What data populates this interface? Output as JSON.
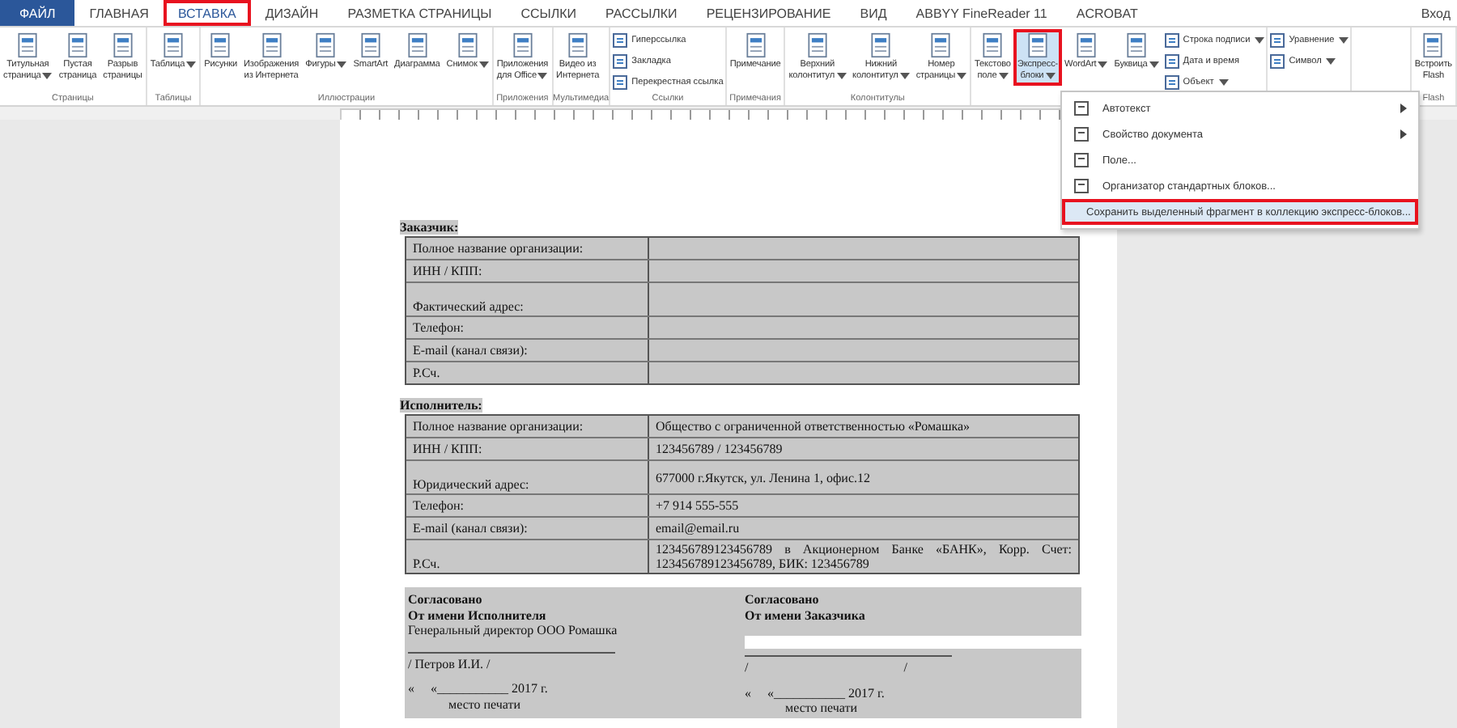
{
  "tabs": [
    {
      "label": "ФАЙЛ",
      "kind": "file",
      "selected": false
    },
    {
      "label": "ГЛАВНАЯ",
      "kind": "tab",
      "selected": false
    },
    {
      "label": "ВСТАВКА",
      "kind": "tab",
      "selected": true
    },
    {
      "label": "ДИЗАЙН",
      "kind": "tab",
      "selected": false
    },
    {
      "label": "РАЗМЕТКА СТРАНИЦЫ",
      "kind": "tab",
      "selected": false
    },
    {
      "label": "ССЫЛКИ",
      "kind": "tab",
      "selected": false
    },
    {
      "label": "РАССЫЛКИ",
      "kind": "tab",
      "selected": false
    },
    {
      "label": "РЕЦЕНЗИРОВАНИЕ",
      "kind": "tab",
      "selected": false
    },
    {
      "label": "ВИД",
      "kind": "tab",
      "selected": false
    },
    {
      "label": "ABBYY FineReader 11",
      "kind": "tab",
      "selected": false
    },
    {
      "label": "ACROBAT",
      "kind": "tab",
      "selected": false
    }
  ],
  "sign_in": "Вход",
  "ribbon": {
    "groups": [
      {
        "label": "Страницы",
        "items": [
          {
            "kind": "large",
            "label": "Титульная\nстраница",
            "dropdown": true,
            "pressed": false
          },
          {
            "kind": "large",
            "label": "Пустая\nстраница",
            "dropdown": false,
            "pressed": false
          },
          {
            "kind": "large",
            "label": "Разрыв\nстраницы",
            "dropdown": false,
            "pressed": false
          }
        ]
      },
      {
        "label": "Таблицы",
        "items": [
          {
            "kind": "large",
            "label": "Таблица",
            "dropdown": true,
            "pressed": false
          }
        ]
      },
      {
        "label": "Иллюстрации",
        "items": [
          {
            "kind": "large",
            "label": "Рисунки",
            "dropdown": false,
            "pressed": false
          },
          {
            "kind": "large",
            "label": "Изображения\nиз Интернета",
            "dropdown": false,
            "pressed": false
          },
          {
            "kind": "large",
            "label": "Фигуры",
            "dropdown": true,
            "pressed": false
          },
          {
            "kind": "large",
            "label": "SmartArt",
            "dropdown": false,
            "pressed": false
          },
          {
            "kind": "large",
            "label": "Диаграмма",
            "dropdown": false,
            "pressed": false
          },
          {
            "kind": "large",
            "label": "Снимок",
            "dropdown": true,
            "pressed": false
          }
        ]
      },
      {
        "label": "Приложения",
        "items": [
          {
            "kind": "large",
            "label": "Приложения\nдля Office",
            "dropdown": true,
            "pressed": false
          }
        ]
      },
      {
        "label": "Мультимедиа",
        "items": [
          {
            "kind": "large",
            "label": "Видео из\nИнтернета",
            "dropdown": false,
            "pressed": false
          }
        ]
      },
      {
        "label": "Ссылки",
        "items": [
          {
            "kind": "small",
            "label": "Гиперссылка",
            "dropdown": false,
            "pressed": false
          },
          {
            "kind": "small",
            "label": "Закладка",
            "dropdown": false,
            "pressed": false
          },
          {
            "kind": "small",
            "label": "Перекрестная ссылка",
            "dropdown": false,
            "pressed": false
          }
        ]
      },
      {
        "label": "Примечания",
        "items": [
          {
            "kind": "large",
            "label": "Примечание",
            "dropdown": false,
            "pressed": false
          }
        ]
      },
      {
        "label": "Колонтитулы",
        "items": [
          {
            "kind": "large",
            "label": "Верхний\nколонтитул",
            "dropdown": true,
            "pressed": false
          },
          {
            "kind": "large",
            "label": "Нижний\nколонтитул",
            "dropdown": true,
            "pressed": false
          },
          {
            "kind": "large",
            "label": "Номер\nстраницы",
            "dropdown": true,
            "pressed": false
          }
        ]
      },
      {
        "items": [
          {
            "kind": "large",
            "label": "Текстово\nполе",
            "dropdown": true,
            "pressed": false
          },
          {
            "kind": "large",
            "label": "Экспресс-\nблоки",
            "dropdown": true,
            "pressed": true
          },
          {
            "kind": "large",
            "label": "WordArt",
            "dropdown": true,
            "pressed": false
          },
          {
            "kind": "large",
            "label": "Буквица",
            "dropdown": true,
            "pressed": false
          },
          {
            "kind": "small",
            "label": "Строка подписи",
            "dropdown": true,
            "pressed": false
          },
          {
            "kind": "small",
            "label": "Дата и время",
            "dropdown": false,
            "pressed": false
          },
          {
            "kind": "small",
            "label": "Объект",
            "dropdown": true,
            "pressed": false
          }
        ]
      },
      {
        "items": [
          {
            "kind": "small",
            "label": "Уравнение",
            "dropdown": true,
            "pressed": false
          },
          {
            "kind": "small",
            "label": "Символ",
            "dropdown": true,
            "pressed": false
          }
        ]
      },
      {
        "label": "Flash",
        "items": [
          {
            "kind": "large",
            "label": "Встроить\nFlash",
            "dropdown": false,
            "pressed": false
          }
        ]
      }
    ]
  },
  "menu": {
    "items": [
      {
        "label": "Автотекст",
        "submenu": true,
        "highlighted": false
      },
      {
        "label": "Свойство документа",
        "submenu": true,
        "highlighted": false
      },
      {
        "label": "Поле...",
        "submenu": false,
        "highlighted": false
      },
      {
        "label": "Организатор стандартных блоков...",
        "submenu": false,
        "highlighted": false
      },
      {
        "label": "Сохранить выделенный фрагмент в коллекцию экспресс-блоков...",
        "submenu": false,
        "highlighted": true
      }
    ]
  },
  "document": {
    "sections": [
      {
        "heading": "Заказчик:",
        "rows": [
          {
            "label": "Полное название организации:",
            "tall": false
          },
          {
            "label": "ИНН / КПП:",
            "tall": false
          },
          {
            "label": "Фактический адрес:",
            "tall": true
          },
          {
            "label": "Телефон:",
            "tall": false
          },
          {
            "label": "E-mail (канал связи):",
            "tall": false
          },
          {
            "label": "Р.Сч.",
            "tall": false
          }
        ]
      },
      {
        "heading": "Исполнитель:",
        "rows": [
          {
            "label": "Полное название организации:",
            "value": "Общество с ограниченной ответственностью «Ромашка»",
            "tall": false
          },
          {
            "label": "ИНН / КПП:",
            "value": "123456789 / 123456789",
            "tall": false
          },
          {
            "label": "Юридический адрес:",
            "value": "677000 г.Якутск, ул. Ленина 1, офис.12",
            "tall": true
          },
          {
            "label": "Телефон:",
            "value": "+7 914 555-555",
            "tall": false
          },
          {
            "label": "E-mail (канал связи):",
            "value": "email@email.ru",
            "tall": false
          },
          {
            "label": "Р.Сч.",
            "value": "123456789123456789 в Акционерном Банке «БАНК», Корр. Счет: 123456789123456789, БИК: 123456789",
            "tall": true
          }
        ]
      }
    ],
    "signatures": [
      {
        "lines": [
          {
            "kind": "bold",
            "text": "Согласовано"
          },
          {
            "kind": "bold",
            "text": "От имени Исполнителя"
          },
          {
            "kind": "plain",
            "text": "Генеральный директор ООО Ромашка"
          },
          {
            "kind": "gap"
          },
          {
            "kind": "rule"
          },
          {
            "kind": "plain",
            "text": "/ Петров И.И. /"
          },
          {
            "kind": "gap"
          },
          {
            "kind": "plain",
            "text": "«     «___________ 2017 г."
          },
          {
            "kind": "indent",
            "text": "место печати"
          }
        ]
      },
      {
        "lines": [
          {
            "kind": "bold",
            "text": "Согласовано"
          },
          {
            "kind": "bold",
            "text": "От имени Заказчика"
          },
          {
            "kind": "gap"
          },
          {
            "kind": "input"
          },
          {
            "kind": "rule"
          },
          {
            "kind": "plain",
            "text": "/                                                /"
          },
          {
            "kind": "gap"
          },
          {
            "kind": "plain",
            "text": "«     «___________ 2017 г."
          },
          {
            "kind": "indent",
            "text": "место печати"
          }
        ]
      }
    ]
  }
}
